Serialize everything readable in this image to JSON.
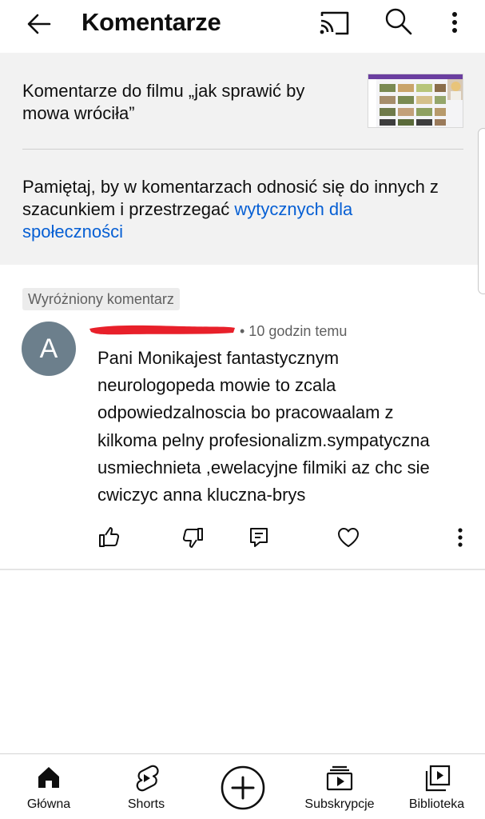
{
  "header": {
    "title": "Komentarze",
    "icons": [
      "back-arrow-icon",
      "cast-icon",
      "search-icon",
      "more-vert-icon"
    ]
  },
  "video": {
    "comments_title": "Komentarze do filmu „jak sprawić by mowa wróciła”"
  },
  "guidelines": {
    "text": "Pamiętaj, by w komentarzach odnosić się do innych z szacunkiem i przestrzegać ",
    "link": "wytycznych dla społeczności"
  },
  "comment": {
    "pinned_label": "Wyróżniony komentarz",
    "avatar_letter": "A",
    "meta": "• 10 godzin temu",
    "text": "Pani Monikajest fantastycznym\nneurologopeda mowie to zcala\nodpowiedzalnoscia bo pracowaalam z\nkilkoma pelny profesionalizm.sympatyczna\nusmiechnieta ,ewelacyjne filmiki az chc sie\ncwiczyc  anna kluczna-brys",
    "actions": [
      "thumb-up-icon",
      "thumb-down-icon",
      "reply-icon",
      "heart-icon",
      "more-vert-icon"
    ]
  },
  "bottom_nav": [
    {
      "label": "Główna",
      "icon": "home-icon"
    },
    {
      "label": "Shorts",
      "icon": "shorts-icon"
    },
    {
      "label": "",
      "icon": "create-plus-icon"
    },
    {
      "label": "Subskrypcje",
      "icon": "subscriptions-icon"
    },
    {
      "label": "Biblioteka",
      "icon": "library-icon"
    }
  ],
  "colors": {
    "link": "#065fd4",
    "panel_bg": "#f2f2f2",
    "avatar_bg": "#6c7f8c",
    "redaction": "#e8202a"
  }
}
